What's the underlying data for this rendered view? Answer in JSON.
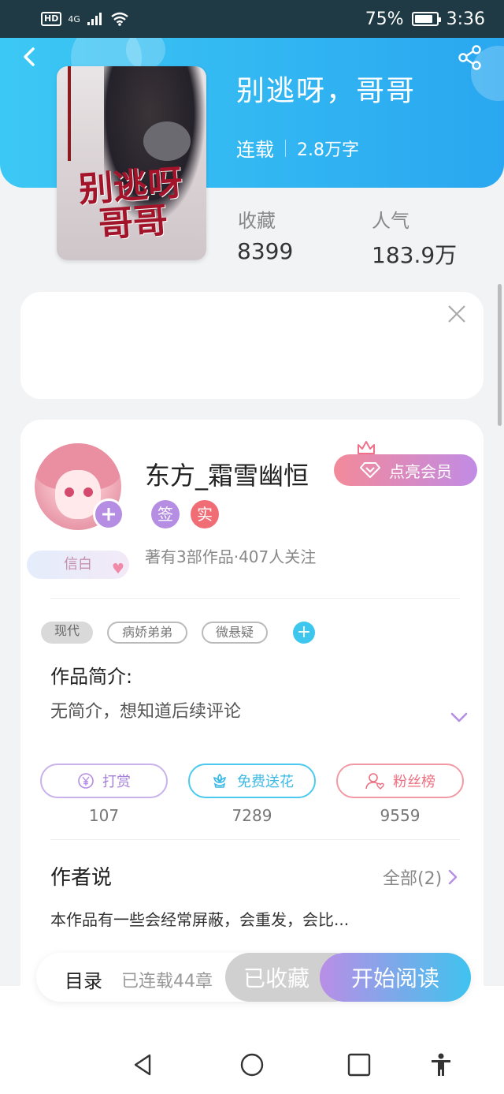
{
  "status_bar": {
    "network": "4G",
    "battery": "75%",
    "time": "3:36"
  },
  "book": {
    "title": "别逃呀，哥哥",
    "status": "连载",
    "word_count": "2.8万字",
    "cover_title": "别逃呀 哥哥",
    "stats": [
      {
        "label": "收藏",
        "value": "8399"
      },
      {
        "label": "人气",
        "value": "183.9万"
      }
    ]
  },
  "author": {
    "name": "东方_霜雪幽恒",
    "badge_sign": "签",
    "badge_real": "实",
    "meta": "著有3部作品·407人关注",
    "title_badge": "信白",
    "vip_button": "点亮会员"
  },
  "tags": [
    "现代",
    "病娇弟弟",
    "微悬疑"
  ],
  "intro": {
    "label": "作品简介:",
    "text": "无简介，想知道后续评论"
  },
  "actions": [
    {
      "label": "打赏",
      "count": "107",
      "icon": "yen-icon"
    },
    {
      "label": "免费送花",
      "count": "7289",
      "icon": "flower-icon"
    },
    {
      "label": "粉丝榜",
      "count": "9559",
      "icon": "user-heart-icon"
    }
  ],
  "author_say": {
    "label": "作者说",
    "all": "全部(2)",
    "text": "本作品有一些会经常屏蔽，会重发，会比..."
  },
  "bottom_bar": {
    "catalog": "目录",
    "chapters": "已连载44章",
    "collected": "已收藏",
    "start_reading": "开始阅读"
  },
  "colors": {
    "header_start": "#3cc8f4",
    "header_end": "#2aa7f0",
    "accent_purple": "#b58ee3",
    "accent_pink": "#f06d76",
    "accent_cyan": "#3dc6ee"
  }
}
